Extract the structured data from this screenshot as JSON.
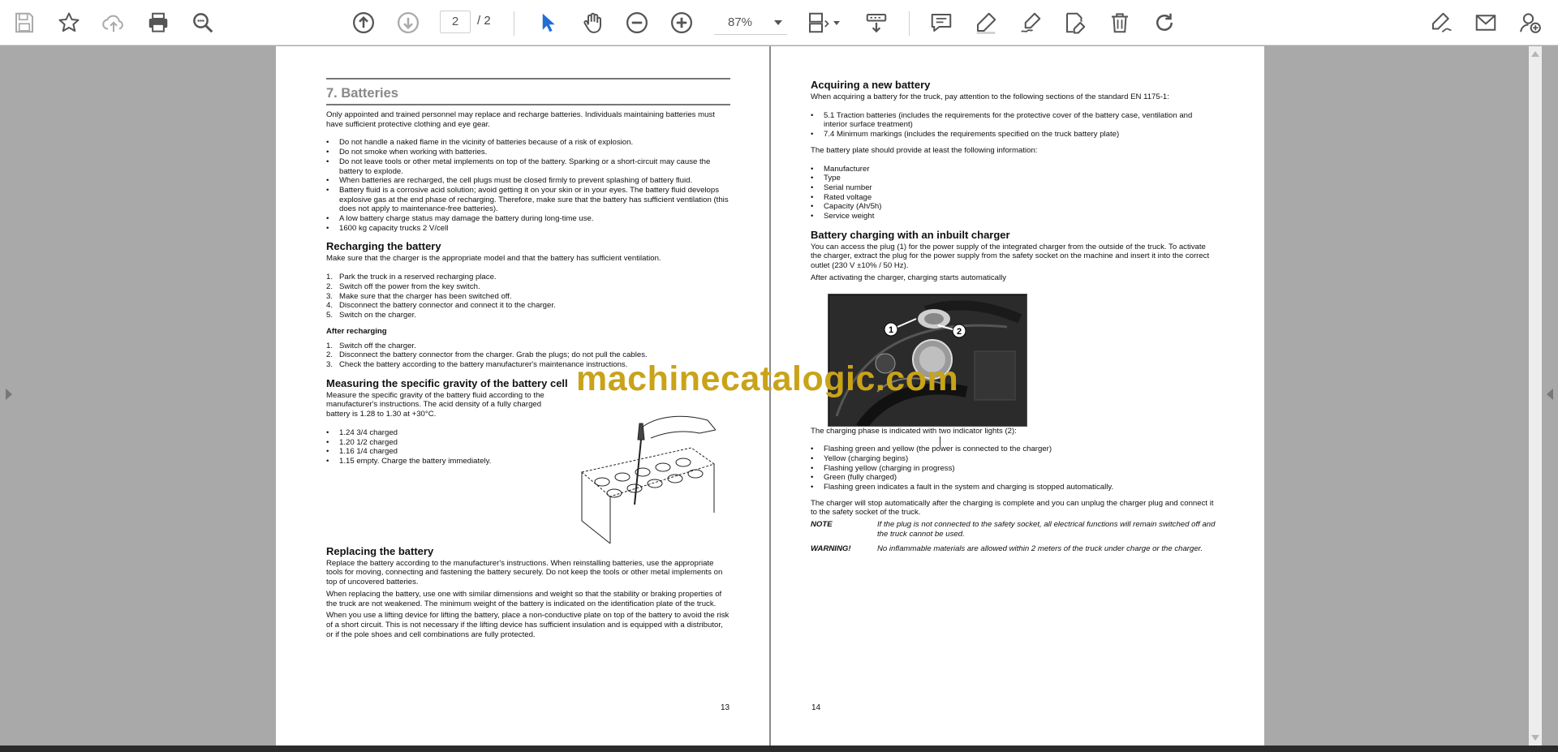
{
  "toolbar": {
    "icons": [
      "save-icon",
      "bookmark-star-icon",
      "upload-cloud-icon",
      "print-icon",
      "zoom-search-icon",
      "page-up-icon",
      "page-down-icon",
      "select-cursor-icon",
      "hand-pan-icon",
      "zoom-out-icon",
      "zoom-in-icon",
      "fit-page-icon",
      "read-mode-icon",
      "comment-icon",
      "highlight-pen-icon",
      "draw-signature-icon",
      "edit-text-icon",
      "delete-icon",
      "rotate-icon",
      "sign-icon",
      "email-icon",
      "add-user-icon"
    ],
    "current_page": "2",
    "total_pages": "/ 2",
    "zoom": "87%"
  },
  "left_page": {
    "chapter_title": "7. Batteries",
    "intro": "Only appointed and trained personnel may replace and recharge batteries. Individuals maintaining batteries must have sufficient protective clothing and eye gear.",
    "safety_bullets": [
      "Do not handle a naked flame in the vicinity of batteries because of a risk of explosion.",
      "Do not smoke when working with batteries.",
      "Do not leave tools or other metal implements on top of the battery. Sparking or a short-circuit may cause the battery to explode.",
      "When batteries are recharged, the cell plugs must be closed firmly to prevent splashing of battery fluid.",
      "Battery fluid is a corrosive acid solution; avoid getting it on your skin or in your eyes. The battery fluid develops explosive gas at the end phase of recharging. Therefore, make sure that the battery has sufficient ventilation (this does not apply to maintenance-free batteries).",
      "A low battery charge status may damage the battery during long-time use.",
      "1600 kg capacity trucks 2 V/cell"
    ],
    "recharging_heading": "Recharging the battery",
    "recharging_intro": "Make sure that the charger is the appropriate model and that the battery has sufficient ventilation.",
    "recharging_steps": [
      "Park the truck in a reserved recharging place.",
      "Switch off the power from the key switch.",
      "Make sure that the charger has been switched off.",
      "Disconnect the battery connector and connect it to the charger.",
      "Switch on the charger."
    ],
    "after_heading": "After recharging",
    "after_steps": [
      "Switch off the charger.",
      "Disconnect the battery connector from the charger. Grab the plugs; do not pull the cables.",
      "Check the battery according to the battery manufacturer's maintenance instructions."
    ],
    "gravity_heading": "Measuring the specific gravity of the battery cell",
    "gravity_text": "Measure the specific gravity of the battery fluid according to the manufacturer's instructions. The acid density of a fully charged battery is 1.28 to 1.30 at +30°C.",
    "gravity_bullets": [
      "1.24 3/4 charged",
      "1.20 1/2 charged",
      "1.16 1/4 charged",
      "1.15 empty. Charge the battery immediately."
    ],
    "replacing_heading": "Replacing the battery",
    "replacing_paragraphs": [
      "Replace the battery according to the manufacturer's instructions. When reinstalling batteries, use the appropriate tools for moving, connecting and fastening the battery securely. Do not keep the tools or other metal implements on top of uncovered batteries.",
      "When replacing the battery, use one with similar dimensions and weight so that the stability or braking properties of the truck are not weakened. The minimum weight of the battery is indicated on the identification plate of the truck.",
      "When you use a lifting device for lifting the battery, place a non-conductive plate on top of the battery to avoid the risk of a short circuit. This is not necessary if the lifting device has sufficient insulation and is equipped with a distributor, or if the pole shoes and cell combinations are fully protected."
    ],
    "page_number": "13"
  },
  "right_page": {
    "acquiring_heading": "Acquiring a new battery",
    "acquiring_intro": "When acquiring a battery for the truck, pay attention to the following sections of the standard EN 1175-1:",
    "standard_bullets": [
      "5.1 Traction batteries (includes the requirements for the protective cover of the battery case, ventilation and interior surface treatment)",
      "7.4 Minimum markings (includes the requirements specified on the truck battery plate)"
    ],
    "plate_intro": "The battery plate should provide at least the following information:",
    "plate_bullets": [
      "Manufacturer",
      "Type",
      "Serial number",
      "Rated voltage",
      "Capacity (Ah/5h)",
      "Service weight"
    ],
    "charger_heading": "Battery charging with an inbuilt charger",
    "charger_text": "You can access the plug (1) for the power supply of the integrated charger from the outside of the truck. To activate the charger, extract the plug for the power supply from the safety socket on the machine and insert it into the correct outlet (230 V ±10% / 50 Hz).",
    "charger_after": "After activating the charger, charging starts automatically",
    "callout_1": "1",
    "callout_2": "2",
    "phase_intro": "The charging phase is indicated with two indicator lights (2):",
    "phase_bullets": [
      "Flashing green and yellow (the power is connected to the charger)",
      "Yellow (charging begins)",
      "Flashing yellow (charging in progress)",
      "Green (fully charged)",
      "Flashing green indicates a fault in the system and charging is stopped automatically."
    ],
    "stop_text": "The charger will stop automatically after the charging is complete and you can unplug the charger plug and connect it to the safety socket of the truck.",
    "note_label": "NOTE",
    "note_text": "If the plug is not connected to the safety socket, all electrical functions will remain switched off and the truck cannot be used.",
    "warning_label": "WARNING!",
    "warning_text": "No inflammable materials are allowed within 2 meters of the truck under charge or the charger.",
    "page_number": "14"
  },
  "watermark": "machinecatalogic.com",
  "colors": {
    "watermark": "#c9a318",
    "accent_blue": "#1f6fd6",
    "viewer_bg": "#a9a9a9",
    "icon_gray": "#555555"
  }
}
